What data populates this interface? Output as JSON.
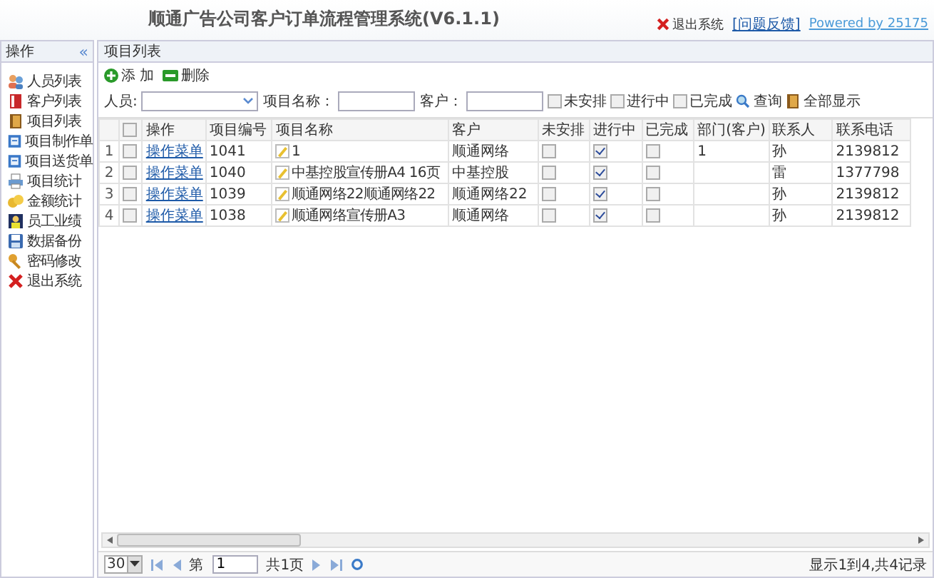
{
  "header": {
    "title": "顺通广告公司客户订单流程管理系统(V6.1.1)",
    "logout": "退出系统",
    "feedback": "[问题反馈]",
    "powered": "Powered by 25175"
  },
  "sidebar": {
    "title": "操作",
    "collapse": "«",
    "items": [
      {
        "label": "人员列表"
      },
      {
        "label": "客户列表"
      },
      {
        "label": "项目列表"
      },
      {
        "label": "项目制作单"
      },
      {
        "label": "项目送货单"
      },
      {
        "label": "项目统计"
      },
      {
        "label": "金额统计"
      },
      {
        "label": "员工业绩"
      },
      {
        "label": "数据备份"
      },
      {
        "label": "密码修改"
      },
      {
        "label": "退出系统"
      }
    ]
  },
  "panel": {
    "title": "项目列表"
  },
  "toolbar": {
    "add": "添 加",
    "delete": "删除"
  },
  "filters": {
    "person_label": "人员:",
    "name_label": "项目名称：",
    "customer_label": "客户：",
    "checks": [
      {
        "label": "未安排",
        "checked": false
      },
      {
        "label": "进行中",
        "checked": false
      },
      {
        "label": "已完成",
        "checked": false
      }
    ],
    "search": "查询",
    "show_all": "全部显示"
  },
  "table": {
    "columns": [
      "操作",
      "项目编号",
      "项目名称",
      "客户",
      "未安排",
      "进行中",
      "已完成",
      "部门(客户)",
      "联系人",
      "联系电话"
    ],
    "header_checked": false,
    "rows": [
      {
        "num": "1",
        "checked": false,
        "action": "操作菜单",
        "code": "1041",
        "name": "1",
        "customer": "顺通网络",
        "unscheduled": false,
        "in_progress": true,
        "done": false,
        "dept": "1",
        "contact": "孙",
        "phone": "2139812"
      },
      {
        "num": "2",
        "checked": false,
        "action": "操作菜单",
        "code": "1040",
        "name": "中基控股宣传册A4 16页",
        "customer": "中基控股",
        "unscheduled": false,
        "in_progress": true,
        "done": false,
        "contact": "雷",
        "phone": "1377798"
      },
      {
        "num": "3",
        "checked": false,
        "action": "操作菜单",
        "code": "1039",
        "name": "顺通网络22顺通网络22",
        "customer": "顺通网络22",
        "unscheduled": false,
        "in_progress": true,
        "done": false,
        "contact": "孙",
        "phone": "2139812"
      },
      {
        "num": "4",
        "checked": false,
        "action": "操作菜单",
        "code": "1038",
        "name": "顺通网络宣传册A3",
        "customer": "顺通网络",
        "unscheduled": false,
        "in_progress": true,
        "done": false,
        "contact": "孙",
        "phone": "2139812"
      }
    ]
  },
  "pager": {
    "page_size": "30",
    "page_prefix": "第",
    "page": "1",
    "total_pages": "共1页",
    "summary": "显示1到4,共4记录"
  }
}
